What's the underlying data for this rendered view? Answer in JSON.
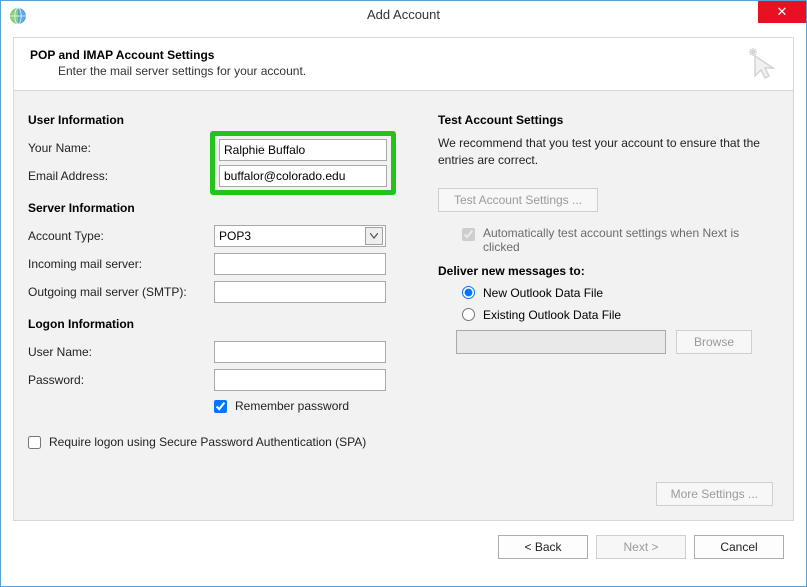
{
  "window": {
    "title": "Add Account",
    "close_symbol": "✕"
  },
  "header": {
    "title": "POP and IMAP Account Settings",
    "subtitle": "Enter the mail server settings for your account."
  },
  "left": {
    "user_info_h": "User Information",
    "your_name_lbl": "Your Name:",
    "your_name_val": "Ralphie Buffalo",
    "email_lbl": "Email Address:",
    "email_val": "buffalor@colorado.edu",
    "server_info_h": "Server Information",
    "account_type_lbl": "Account Type:",
    "account_type_val": "POP3",
    "incoming_lbl": "Incoming mail server:",
    "incoming_val": "",
    "outgoing_lbl": "Outgoing mail server (SMTP):",
    "outgoing_val": "",
    "logon_info_h": "Logon Information",
    "username_lbl": "User Name:",
    "username_val": "",
    "password_lbl": "Password:",
    "password_val": "",
    "remember_lbl": "Remember password",
    "remember_checked": true,
    "spa_lbl": "Require logon using Secure Password Authentication (SPA)",
    "spa_checked": false
  },
  "right": {
    "test_h": "Test Account Settings",
    "test_desc": "We recommend that you test your account to ensure that the entries are correct.",
    "test_btn": "Test Account Settings ...",
    "auto_test_lbl": "Automatically test account settings when Next is clicked",
    "auto_test_checked": true,
    "deliver_h": "Deliver new messages to:",
    "radio_new": "New Outlook Data File",
    "radio_existing": "Existing Outlook Data File",
    "radio_selected": "new",
    "existing_path": "",
    "browse_btn": "Browse",
    "more_btn": "More Settings ..."
  },
  "footer": {
    "back": "< Back",
    "next": "Next >",
    "cancel": "Cancel"
  }
}
